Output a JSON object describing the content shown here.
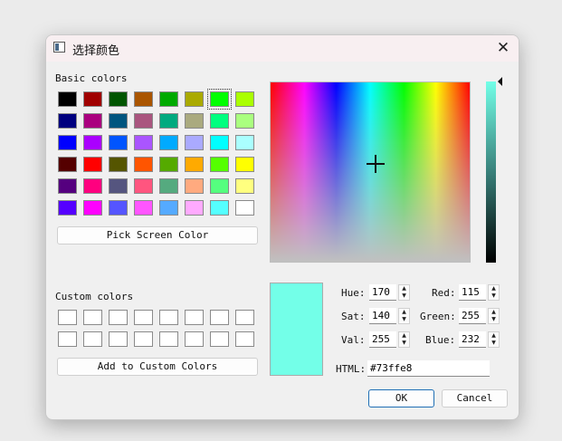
{
  "window": {
    "title": "选择颜色",
    "close_icon": "✕"
  },
  "basic_colors": {
    "label": "Basic colors",
    "selected_index": 5,
    "rows": [
      [
        "#000000",
        "#a00000",
        "#005500",
        "#aa5500",
        "#00aa00",
        "#aaaa00",
        "#00ff00",
        "#aaff00"
      ],
      [
        "#00007f",
        "#aa007f",
        "#00557f",
        "#aa557f",
        "#00aa7f",
        "#aaaa7f",
        "#00ff7f",
        "#aaff7f"
      ],
      [
        "#0000ff",
        "#aa00ff",
        "#0055ff",
        "#aa55ff",
        "#00aaff",
        "#aaaaff",
        "#00ffff",
        "#aaffff"
      ],
      [
        "#550000",
        "#ff0000",
        "#555500",
        "#ff5500",
        "#55aa00",
        "#ffaa00",
        "#55ff00",
        "#ffff00"
      ],
      [
        "#55007f",
        "#ff007f",
        "#55557f",
        "#ff557f",
        "#55aa7f",
        "#ffaa7f",
        "#55ff7f",
        "#ffff7f"
      ],
      [
        "#5500ff",
        "#ff00ff",
        "#5555ff",
        "#ff55ff",
        "#55aaff",
        "#ffaaff",
        "#55ffff",
        "#ffffff"
      ]
    ]
  },
  "pick_screen_label": "Pick Screen Color",
  "custom_colors": {
    "label": "Custom colors"
  },
  "add_custom_label": "Add to Custom Colors",
  "fields": {
    "hue": {
      "label": "Hue:",
      "value": "170"
    },
    "sat": {
      "label": "Sat:",
      "value": "140"
    },
    "val": {
      "label": "Val:",
      "value": "255"
    },
    "red": {
      "label": "Red:",
      "value": "115"
    },
    "green": {
      "label": "Green:",
      "value": "255"
    },
    "blue": {
      "label": "Blue:",
      "value": "232"
    },
    "html": {
      "label": "HTML:",
      "value": "#73ffe8"
    }
  },
  "current_color": "#73ffe8",
  "buttons": {
    "ok": "OK",
    "cancel": "Cancel"
  }
}
